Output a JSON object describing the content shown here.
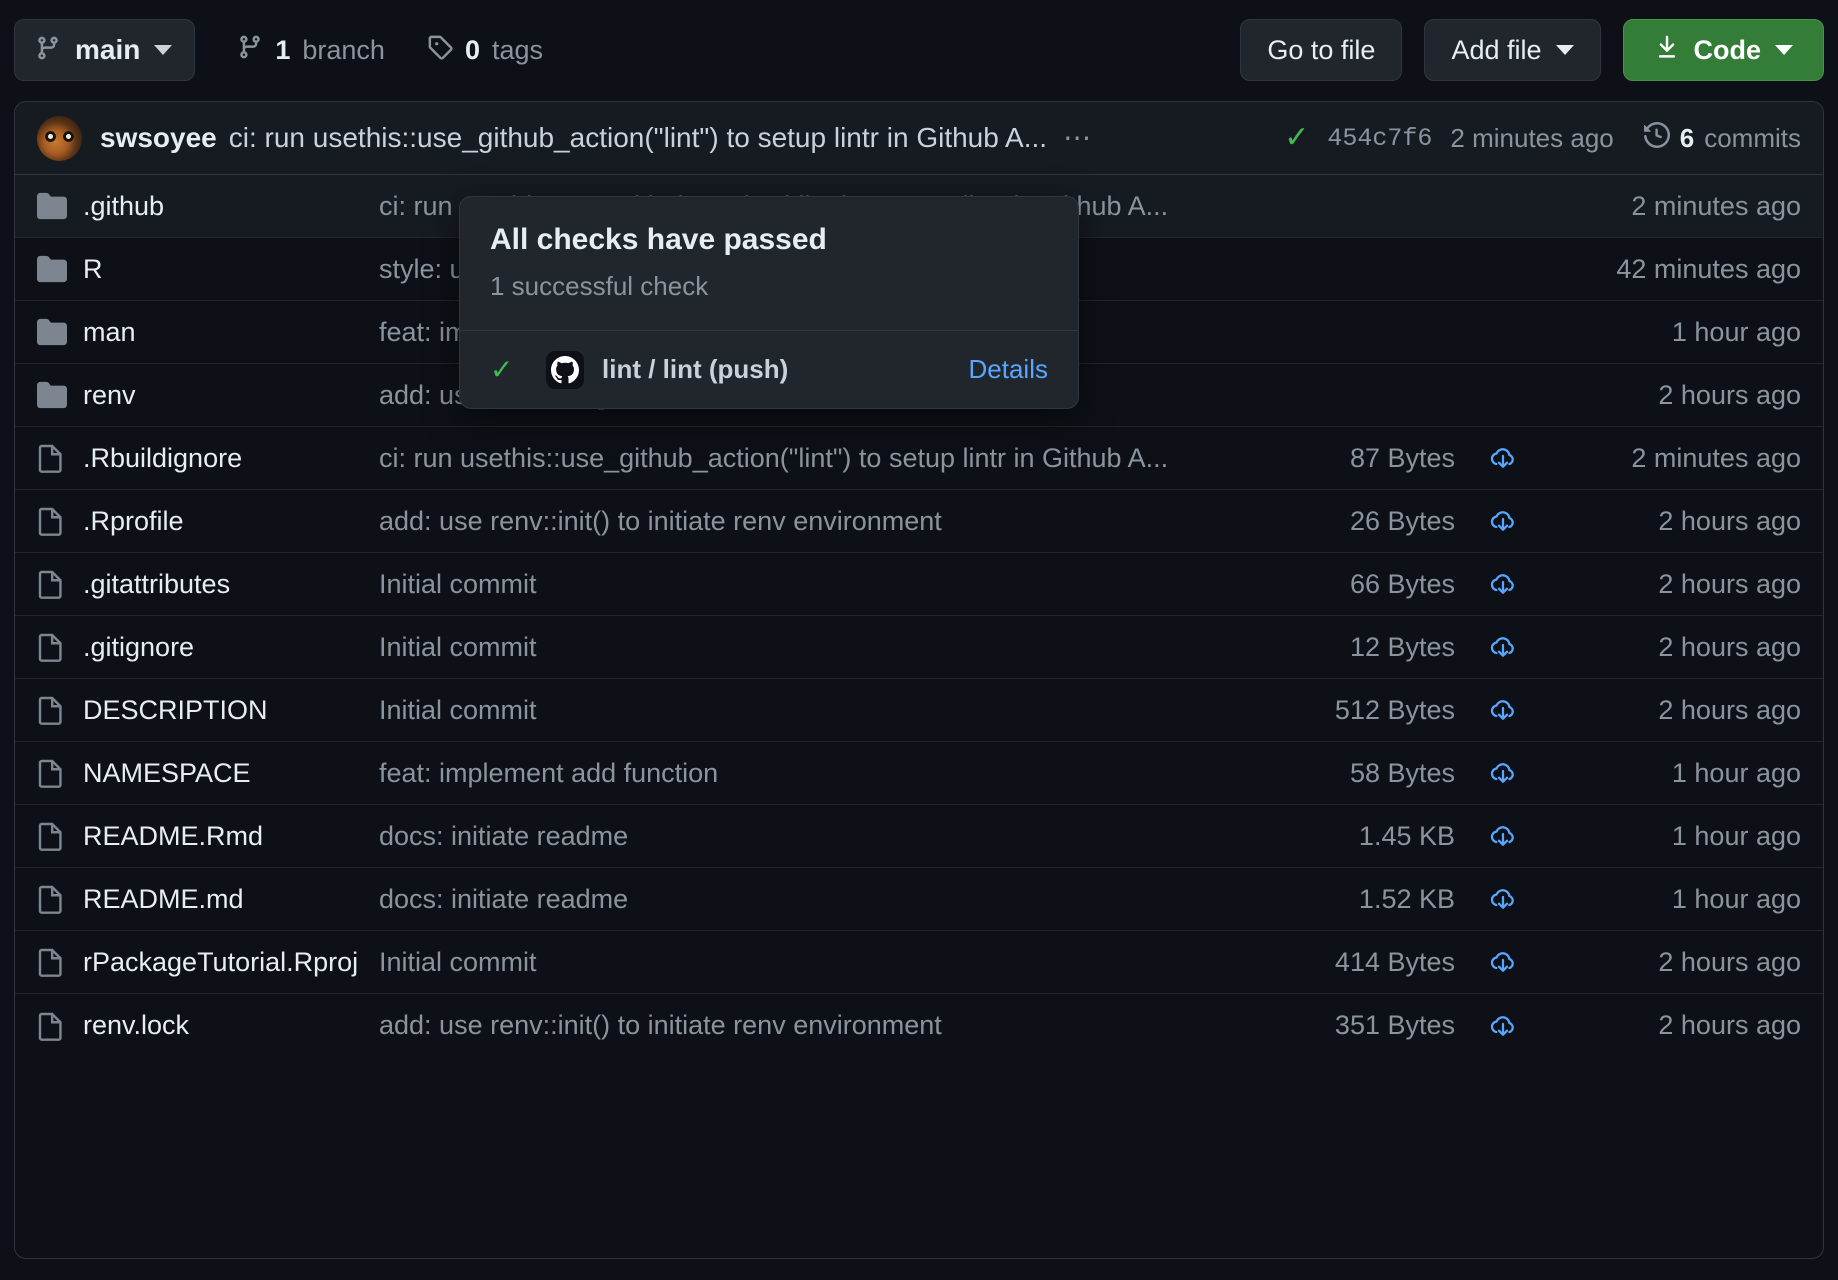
{
  "toolbar": {
    "branch_button": {
      "label": "main",
      "icon": "branch-icon",
      "caret": "chevron-down-icon"
    },
    "branch_count": {
      "value": "1",
      "label": "branch",
      "icon": "branch-icon"
    },
    "tag_count": {
      "value": "0",
      "label": "tags",
      "icon": "tag-icon"
    },
    "go_to_file": "Go to file",
    "add_file": "Add file",
    "code": "Code"
  },
  "commit_header": {
    "author": "swsoyee",
    "message": "ci: run usethis::use_github_action(\"lint\") to setup lintr in Github A...",
    "ellipsis": "…",
    "status_icon": "check-circle-icon",
    "sha": "454c7f6",
    "time": "2 minutes ago",
    "commits_count": "6",
    "commits_label": "commits",
    "history_icon": "history-icon"
  },
  "checks_popover": {
    "title": "All checks have passed",
    "subtitle": "1 successful check",
    "check_icon": "check-icon",
    "provider_icon": "github-mark-icon",
    "check_name": "lint / lint (push)",
    "details_link": "Details"
  },
  "colors": {
    "background": "#0d1117",
    "border": "#30363d",
    "accent_green": "#347d39",
    "success_green": "#3fb950",
    "link_blue": "#58a6ff",
    "muted_text": "#8b949e",
    "primary_text": "#e6edf3"
  },
  "files": [
    {
      "icon": "folder-icon",
      "name": ".github",
      "message": "ci: run usethis::use_github_action(\"lint\") to setup lintr in Github A...",
      "size": "",
      "download": false,
      "time": "2 minutes ago",
      "hovered": true
    },
    {
      "icon": "folder-icon",
      "name": "R",
      "message": "style: use styler::style_pkg() to format code",
      "size": "",
      "download": false,
      "time": "42 minutes ago",
      "hovered": false
    },
    {
      "icon": "folder-icon",
      "name": "man",
      "message": "feat: implement add function",
      "size": "",
      "download": false,
      "time": "1 hour ago",
      "hovered": false
    },
    {
      "icon": "folder-icon",
      "name": "renv",
      "message": "add: use renv::init() to initiate renv environment",
      "size": "",
      "download": false,
      "time": "2 hours ago",
      "hovered": false
    },
    {
      "icon": "file-icon",
      "name": ".Rbuildignore",
      "message": "ci: run usethis::use_github_action(\"lint\") to setup lintr in Github A...",
      "size": "87 Bytes",
      "download": true,
      "time": "2 minutes ago",
      "hovered": false
    },
    {
      "icon": "file-icon",
      "name": ".Rprofile",
      "message": "add: use renv::init() to initiate renv environment",
      "size": "26 Bytes",
      "download": true,
      "time": "2 hours ago",
      "hovered": false
    },
    {
      "icon": "file-icon",
      "name": ".gitattributes",
      "message": "Initial commit",
      "size": "66 Bytes",
      "download": true,
      "time": "2 hours ago",
      "hovered": false
    },
    {
      "icon": "file-icon",
      "name": ".gitignore",
      "message": "Initial commit",
      "size": "12 Bytes",
      "download": true,
      "time": "2 hours ago",
      "hovered": false
    },
    {
      "icon": "file-icon",
      "name": "DESCRIPTION",
      "message": "Initial commit",
      "size": "512 Bytes",
      "download": true,
      "time": "2 hours ago",
      "hovered": false
    },
    {
      "icon": "file-icon",
      "name": "NAMESPACE",
      "message": "feat: implement add function",
      "size": "58 Bytes",
      "download": true,
      "time": "1 hour ago",
      "hovered": false
    },
    {
      "icon": "file-icon",
      "name": "README.Rmd",
      "message": "docs: initiate readme",
      "size": "1.45 KB",
      "download": true,
      "time": "1 hour ago",
      "hovered": false
    },
    {
      "icon": "file-icon",
      "name": "README.md",
      "message": "docs: initiate readme",
      "size": "1.52 KB",
      "download": true,
      "time": "1 hour ago",
      "hovered": false
    },
    {
      "icon": "file-icon",
      "name": "rPackageTutorial.Rproj",
      "message": "Initial commit",
      "size": "414 Bytes",
      "download": true,
      "time": "2 hours ago",
      "hovered": false
    },
    {
      "icon": "file-icon",
      "name": "renv.lock",
      "message": "add: use renv::init() to initiate renv environment",
      "size": "351 Bytes",
      "download": true,
      "time": "2 hours ago",
      "hovered": false
    }
  ]
}
